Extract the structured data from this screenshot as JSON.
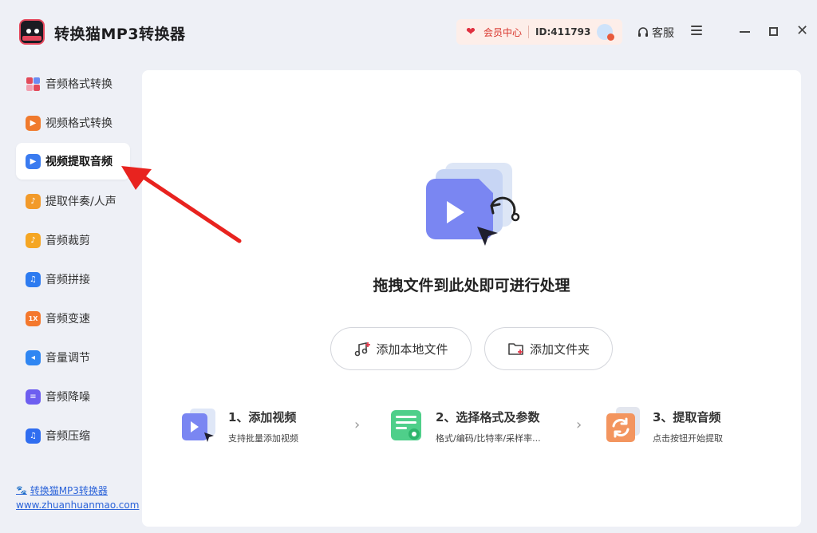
{
  "app": {
    "title": "转换猫MP3转换器",
    "member_center": "会员中心",
    "user_id": "ID:411793",
    "service": "客服"
  },
  "sidebar": {
    "items": [
      {
        "label": "音频格式转换",
        "icon": "audio-convert-icon",
        "color": "#e24a5a"
      },
      {
        "label": "视频格式转换",
        "icon": "video-convert-icon",
        "color": "#f07a2d"
      },
      {
        "label": "视频提取音频",
        "icon": "video-extract-audio-icon",
        "color": "#3a7bf0",
        "active": true
      },
      {
        "label": "提取伴奏/人声",
        "icon": "vocal-extract-icon",
        "color": "#f29a2a"
      },
      {
        "label": "音频裁剪",
        "icon": "audio-cut-icon",
        "color": "#f5a623"
      },
      {
        "label": "音频拼接",
        "icon": "audio-join-icon",
        "color": "#2d7bf0"
      },
      {
        "label": "音频变速",
        "icon": "audio-speed-icon",
        "color": "#f4782d"
      },
      {
        "label": "音量调节",
        "icon": "volume-icon",
        "color": "#2f86f2"
      },
      {
        "label": "音频降噪",
        "icon": "denoise-icon",
        "color": "#6d5ef0"
      },
      {
        "label": "音频压缩",
        "icon": "audio-compress-icon",
        "color": "#2f6df0"
      }
    ],
    "footer_name": "转换猫MP3转换器",
    "footer_url": "www.zhuanhuanmao.com"
  },
  "main": {
    "drop_hint": "拖拽文件到此处即可进行处理",
    "add_local_file": "添加本地文件",
    "add_folder": "添加文件夹",
    "steps": [
      {
        "title": "1、添加视频",
        "desc": "支持批量添加视频"
      },
      {
        "title": "2、选择格式及参数",
        "desc": "格式/编码/比特率/采样率..."
      },
      {
        "title": "3、提取音频",
        "desc": "点击按钮开始提取"
      }
    ]
  }
}
